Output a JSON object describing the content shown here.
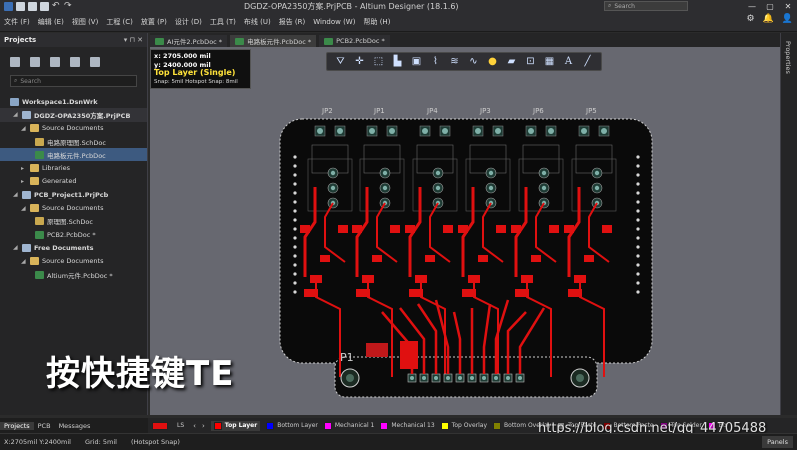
{
  "app": {
    "title": "DGDZ-OPA2350方案.PrjPCB - Altium Designer (18.1.6)",
    "search_placeholder": "Search"
  },
  "menu": [
    {
      "label": "文件 (F)"
    },
    {
      "label": "编辑 (E)"
    },
    {
      "label": "视图 (V)"
    },
    {
      "label": "工程 (C)"
    },
    {
      "label": "放置 (P)"
    },
    {
      "label": "设计 (D)"
    },
    {
      "label": "工具 (T)"
    },
    {
      "label": "布线 (U)"
    },
    {
      "label": "报告 (R)"
    },
    {
      "label": "Window (W)"
    },
    {
      "label": "帮助 (H)"
    }
  ],
  "projects_panel": {
    "title": "Projects",
    "search_placeholder": "Search",
    "tree": [
      {
        "label": "Workspace1.DsnWrk",
        "icon": "workspace-icon",
        "bold": true
      },
      {
        "label": "DGDZ-OPA2350方案.PrjPCB",
        "icon": "project-icon",
        "bold": true,
        "selected_bg": true
      },
      {
        "label": "Source Documents",
        "icon": "folder-icon"
      },
      {
        "label": "电路原理图.SchDoc",
        "icon": "schdoc-icon"
      },
      {
        "label": "电路板元件.PcbDoc",
        "icon": "pcbdoc-icon",
        "selected": true
      },
      {
        "label": "Libraries",
        "icon": "folder-icon"
      },
      {
        "label": "Generated",
        "icon": "folder-icon"
      },
      {
        "label": "PCB_Project1.PrjPcb",
        "icon": "project-icon",
        "bold": true
      },
      {
        "label": "Source Documents",
        "icon": "folder-icon"
      },
      {
        "label": "原理图.SchDoc",
        "icon": "schdoc-icon"
      },
      {
        "label": "PCB2.PcbDoc *",
        "icon": "pcbdoc-icon"
      },
      {
        "label": "Free Documents",
        "icon": "project-icon",
        "bold": true
      },
      {
        "label": "Source Documents",
        "icon": "folder-icon"
      },
      {
        "label": "Altium元件.PcbDoc *",
        "icon": "pcbdoc-icon"
      }
    ],
    "bottom_tabs": [
      "Projects",
      "PCB",
      "Messages"
    ]
  },
  "doc_tabs": [
    {
      "label": "AI元件2.PcbDoc *"
    },
    {
      "label": "电路板元件.PcbDoc *",
      "active": true
    },
    {
      "label": "PCB2.PcbDoc *"
    }
  ],
  "hud": {
    "x": "x: 2705.000 mil",
    "y": "y: 2400.000 mil",
    "layer": "Top Layer (Single)",
    "snap": "Snap: 5mil Hotspot Snap: 8mil"
  },
  "toolbar_icons": [
    "filter-icon",
    "move-icon",
    "select-icon",
    "chart-icon",
    "component-icon",
    "interactive-route-icon",
    "multi-route-icon",
    "differential-route-icon",
    "pad-icon",
    "polygon-icon",
    "via-icon",
    "fill-icon",
    "string-icon",
    "line-icon"
  ],
  "board": {
    "jumper_labels": [
      "JP2",
      "JP1",
      "JP4",
      "JP3",
      "JP6",
      "JP5"
    ],
    "connector_label": "P1"
  },
  "caption": "按快捷键TE",
  "layers": {
    "current_color": "#e01010",
    "ls_label": "LS",
    "items": [
      {
        "label": "Top Layer",
        "color": "#ff0000",
        "active": true
      },
      {
        "label": "Bottom Layer",
        "color": "#0000ff"
      },
      {
        "label": "Mechanical 1",
        "color": "#ff00ff"
      },
      {
        "label": "Mechanical 13",
        "color": "#ff00ff"
      },
      {
        "label": "Top Overlay",
        "color": "#ffff00"
      },
      {
        "label": "Bottom Overlay",
        "color": "#808000"
      },
      {
        "label": "Top Paste",
        "color": "#808080"
      },
      {
        "label": "Bottom Paste",
        "color": "#800000"
      },
      {
        "label": "Top Solder",
        "color": "#800080"
      },
      {
        "label": "Bo",
        "color": "#ff00ff"
      }
    ]
  },
  "status": {
    "coords": "X:2705mil Y:2400mil",
    "grid": "Grid: 5mil",
    "snap": "(Hotspot Snap)",
    "panels_button": "Panels"
  },
  "watermark": "https://blog.csdn.net/qq_44705488",
  "right_sidebar": "Properties"
}
